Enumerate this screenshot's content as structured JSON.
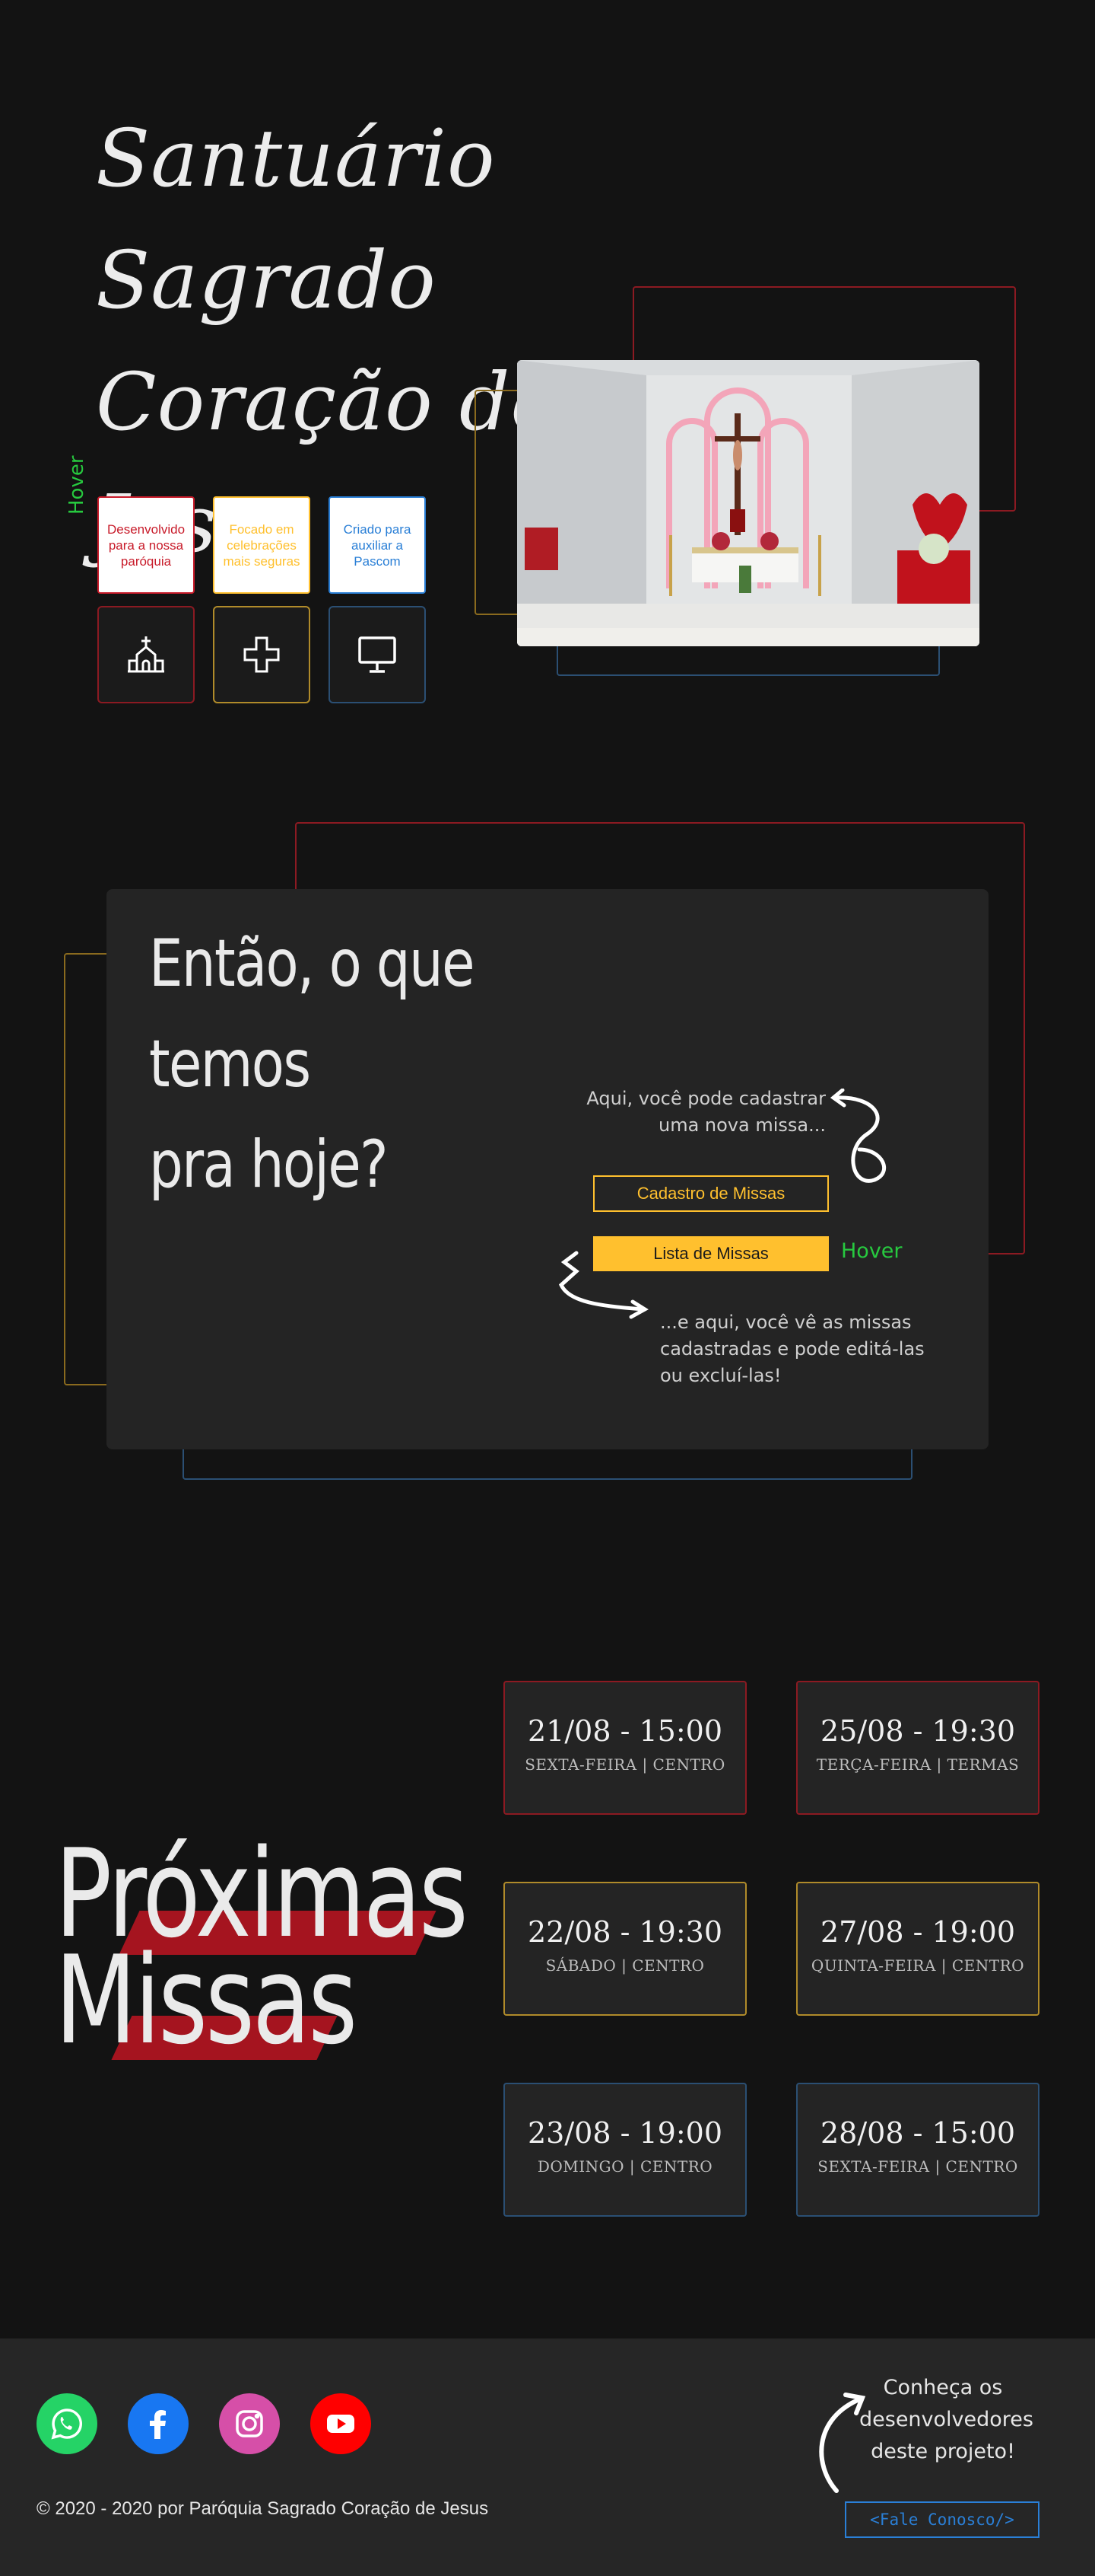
{
  "hero": {
    "title_lines": [
      "Santuário Sagrado",
      "Coração de",
      "Jesus"
    ],
    "hover_label": "Hover",
    "cards": [
      {
        "text": "Desenvolvido para a nossa paróquia",
        "color": "#c81b2a"
      },
      {
        "text": "Focado em celebrações mais seguras",
        "color": "#ffc02e"
      },
      {
        "text": "Criado para auxiliar a Pascom",
        "color": "#2a7fd6"
      }
    ],
    "icons": [
      "church-icon",
      "cross-plus-icon",
      "monitor-icon"
    ]
  },
  "today": {
    "title_line1": "Então, o que temos",
    "title_line2": "pra hoje?",
    "note_top_line1": "Aqui, você pode cadastrar",
    "note_top_line2": "uma nova missa...",
    "register_button": "Cadastro de Missas",
    "list_button": "Lista de Missas",
    "hover_label": "Hover",
    "note_bottom_line1": "...e aqui, você vê as missas",
    "note_bottom_line2": "cadastradas e pode editá-las",
    "note_bottom_line3": "ou excluí-las!"
  },
  "upcoming": {
    "title_line1": "Próximas",
    "title_line2": "Missas",
    "masses": [
      {
        "datetime": "21/08 - 15:00",
        "info": "SEXTA-FEIRA | CENTRO",
        "color": "#8c1a22"
      },
      {
        "datetime": "25/08 - 19:30",
        "info": "TERÇA-FEIRA | TERMAS",
        "color": "#8c1a22"
      },
      {
        "datetime": "22/08 - 19:30",
        "info": "SÁBADO | CENTRO",
        "color": "#b08b2a"
      },
      {
        "datetime": "27/08 - 19:00",
        "info": "QUINTA-FEIRA | CENTRO",
        "color": "#b08b2a"
      },
      {
        "datetime": "23/08 - 19:00",
        "info": "DOMINGO | CENTRO",
        "color": "#2b4f73"
      },
      {
        "datetime": "28/08 - 15:00",
        "info": "SEXTA-FEIRA | CENTRO",
        "color": "#2b4f73"
      }
    ]
  },
  "footer": {
    "socials": [
      {
        "name": "whatsapp-icon",
        "color": "#25d366"
      },
      {
        "name": "facebook-icon",
        "color": "#1877f2"
      },
      {
        "name": "instagram-icon",
        "color": "#d64fa8"
      },
      {
        "name": "youtube-icon",
        "color": "#ff0000"
      }
    ],
    "copyright": "© 2020 - 2020 por Paróquia Sagrado Coração de Jesus",
    "dev_note_line1": "Conheça os",
    "dev_note_line2": "desenvolvedores",
    "dev_note_line3": "deste projeto!",
    "contact_button": "<Fale Conosco/>"
  },
  "colors": {
    "background": "#131313",
    "panel": "#242424",
    "accent_red": "#c81b2a",
    "accent_yellow": "#ffc02e",
    "accent_blue": "#2a7fd6",
    "hover_green": "#27c93f"
  }
}
